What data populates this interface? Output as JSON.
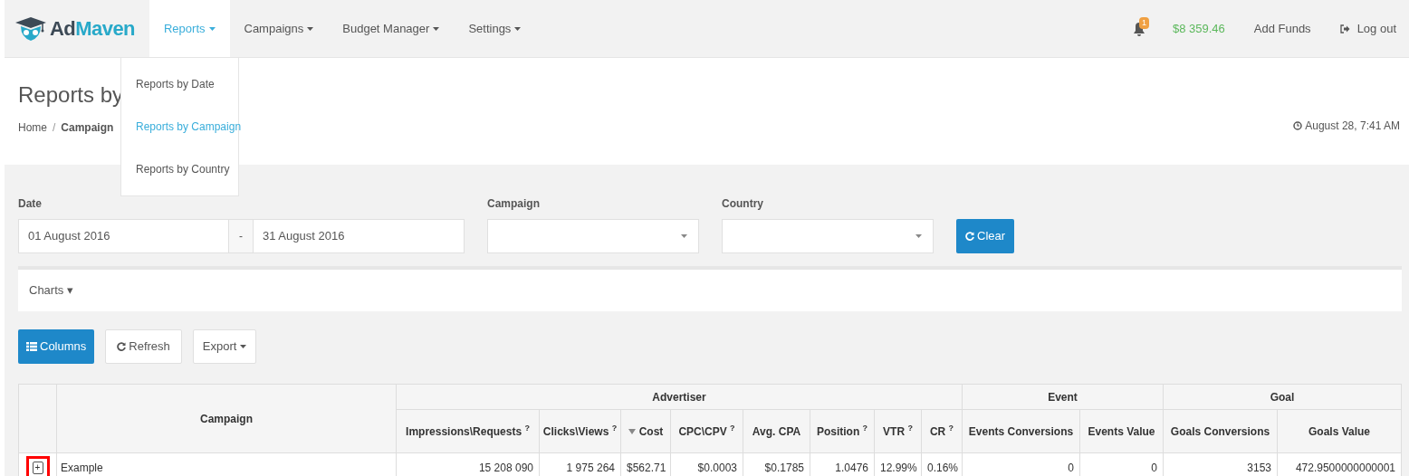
{
  "brand": {
    "name_dark": "Ad",
    "name_light": "Maven"
  },
  "nav": [
    {
      "label": "Reports",
      "selected": true
    },
    {
      "label": "Campaigns",
      "selected": false
    },
    {
      "label": "Budget Manager",
      "selected": false
    },
    {
      "label": "Settings",
      "selected": false
    }
  ],
  "dropdown": [
    {
      "label": "Reports by Date",
      "selected": false
    },
    {
      "label": "Reports by Campaign",
      "selected": true
    },
    {
      "label": "Reports by Country",
      "selected": false
    }
  ],
  "notifications": {
    "count": "1"
  },
  "balance": "$8 359.46",
  "add_funds": "Add Funds",
  "logout": "Log out",
  "page_title": "Reports by",
  "breadcrumb": {
    "home": "Home",
    "separator": "/",
    "current": "Campaign"
  },
  "timestamp": "August 28, 7:41 AM",
  "filters": {
    "date_label": "Date",
    "date_from": "01 August 2016",
    "date_separator": "-",
    "date_to": "31 August 2016",
    "campaign_label": "Campaign",
    "country_label": "Country",
    "clear": "Clear"
  },
  "charts_toggle": "Charts ▾",
  "toolbar": {
    "columns": "Columns",
    "refresh": "Refresh",
    "export": "Export"
  },
  "table": {
    "campaign_header": "Campaign",
    "groups": [
      {
        "label": "Advertiser",
        "columns": [
          {
            "label": "Impressions\\Requests $^{?}$",
            "sorted": false
          },
          {
            "label": "Clicks\\Views $^{?}$",
            "sorted": false
          },
          {
            "label": "Cost",
            "sorted": true
          },
          {
            "label": "CPC\\CPV $^{?}$",
            "sorted": false
          },
          {
            "label": "Avg. CPA",
            "sorted": false
          },
          {
            "label": "Position $^{?}$",
            "sorted": false
          },
          {
            "label": "VTR $^{?}$",
            "sorted": false
          },
          {
            "label": "CR $^{?}$",
            "sorted": false
          }
        ]
      },
      {
        "label": "Event",
        "columns": [
          {
            "label": "Events Conversions",
            "sorted": false
          },
          {
            "label": "Events Value",
            "sorted": false
          }
        ]
      },
      {
        "label": "Goal",
        "columns": [
          {
            "label": "Goals Conversions",
            "sorted": false
          },
          {
            "label": "Goals Value",
            "sorted": false
          }
        ]
      }
    ],
    "rows": [
      {
        "expand": "+",
        "highlighted": true,
        "campaign": "Example",
        "cells": [
          "15 208 090",
          "1 975 264",
          "$562.71",
          "$0.0003",
          "$0.1785",
          "1.0476",
          "12.99%",
          "0.16%",
          "0",
          "0",
          "3153",
          "472.9500000000001"
        ]
      }
    ]
  }
}
